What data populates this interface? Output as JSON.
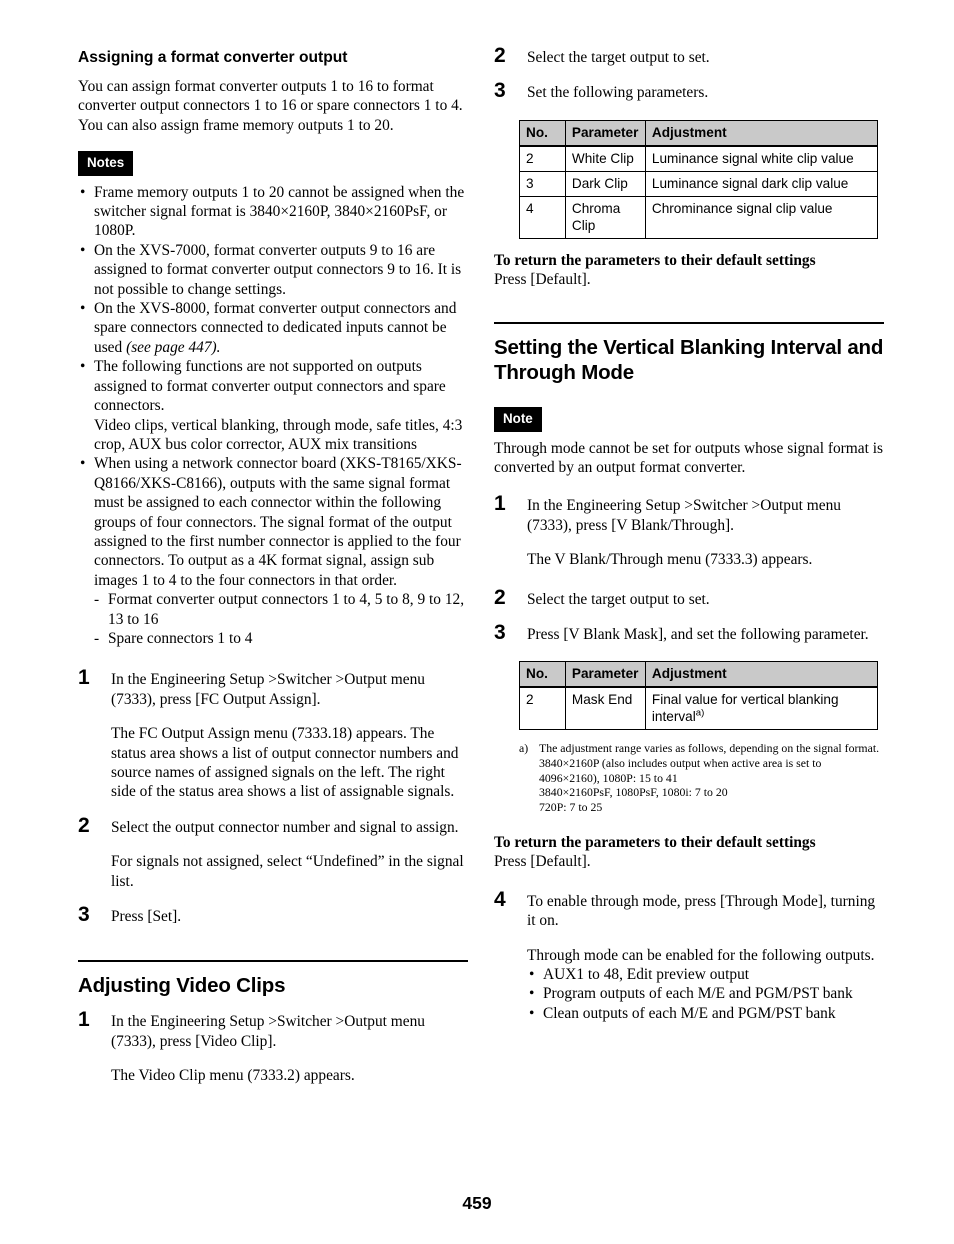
{
  "page": {
    "number": "459"
  },
  "left_column": {
    "heading": "Assigning a format converter output",
    "intro": [
      "You can assign format converter outputs 1 to 16 to format converter output connectors 1 to 16 or spare connectors 1 to 4.",
      "You can also assign frame memory outputs 1 to 20."
    ],
    "notes_badge": "Notes",
    "notes": [
      "Frame memory outputs 1 to 20 cannot be assigned when the switcher signal format is 3840×2160P, 3840×2160PsF, or 1080P.",
      "On the XVS-7000, format converter outputs 9 to 16 are assigned to format converter output connectors 9 to 16. It is not possible to change settings.",
      "The following functions are not supported on outputs assigned to format converter output connectors and spare connectors."
    ],
    "note_xvs8000_text": "On the XVS-8000, format converter output connectors and spare connectors connected to dedicated inputs cannot be used ",
    "note_xvs8000_italic": "(see page 447).",
    "note_functions_list": "Video clips, vertical blanking, through mode, safe titles, 4:3 crop, AUX bus color corrector, AUX mix transitions",
    "note_network_board": "When using a network connector board (XKS-T8165/XKS-Q8166/XKS-C8166), outputs with the same signal format must be assigned to each connector within the following groups of four connectors. The signal format of the output assigned to the first number connector is applied to the four connectors. To output as a 4K format signal, assign sub images 1 to 4 to the four connectors in that order.",
    "sub_items": [
      "Format converter output connectors 1 to 4, 5 to 8, 9 to 12, 13 to 16",
      "Spare connectors 1 to 4"
    ],
    "steps": [
      {
        "num": "1",
        "text": "In the Engineering Setup >Switcher >Output menu (7333), press [FC Output Assign].",
        "detail": "The FC Output Assign menu (7333.18) appears. The status area shows a list of output connector numbers and source names of assigned signals on the left. The right side of the status area shows a list of assignable signals."
      },
      {
        "num": "2",
        "text": "Select the output connector number and signal to assign.",
        "detail": "For signals not assigned, select “Undefined” in the signal list."
      },
      {
        "num": "3",
        "text": "Press [Set].",
        "detail": ""
      }
    ],
    "video_clips": {
      "heading": "Adjusting Video Clips",
      "step_num": "1",
      "step_text": "In the Engineering Setup >Switcher >Output menu (7333), press [Video Clip].",
      "step_detail": "The Video Clip menu (7333.2) appears."
    }
  },
  "right_column": {
    "steps_top": [
      {
        "num": "2",
        "text": "Select the target output to set."
      },
      {
        "num": "3",
        "text": "Set the following parameters."
      }
    ],
    "table_clip": {
      "headers": [
        "No.",
        "Parameter",
        "Adjustment"
      ],
      "rows": [
        {
          "no": "2",
          "parameter": "White Clip",
          "adjustment": "Luminance signal white clip value"
        },
        {
          "no": "3",
          "parameter": "Dark Clip",
          "adjustment": "Luminance signal dark clip value"
        },
        {
          "no": "4",
          "parameter": "Chroma Clip",
          "adjustment": "Chrominance signal clip value"
        }
      ]
    },
    "default_heading_1": "To return the parameters to their default settings",
    "default_text_1": "Press [Default].",
    "vblank": {
      "heading": "Setting the Vertical Blanking Interval and Through Mode",
      "note_badge": "Note",
      "note_text": "Through mode cannot be set for outputs whose signal format is converted by an output format converter.",
      "steps": [
        {
          "num": "1",
          "text": "In the Engineering Setup >Switcher >Output menu (7333), press [V Blank/Through].",
          "detail": "The V Blank/Through menu (7333.3) appears."
        },
        {
          "num": "2",
          "text": "Select the target output to set.",
          "detail": ""
        },
        {
          "num": "3",
          "text": "Press [V Blank Mask], and set the following parameter.",
          "detail": ""
        }
      ],
      "table_mask": {
        "headers": [
          "No.",
          "Parameter",
          "Adjustment"
        ],
        "rows": [
          {
            "no": "2",
            "parameter": "Mask End",
            "adjustment": "Final value for vertical blanking interval",
            "footnote_mark": "a)"
          }
        ]
      },
      "footnote": {
        "mark": "a)",
        "lines": [
          "The adjustment range varies as follows, depending on the signal format.",
          "3840×2160P (also includes output when active area is set to 4096×2160), 1080P: 15 to 41",
          "3840×2160PsF, 1080PsF, 1080i: 7 to 20",
          "720P: 7 to 25"
        ]
      },
      "default_heading_2": "To return the parameters to their default settings",
      "default_text_2": "Press [Default].",
      "step4": {
        "num": "4",
        "text": "To enable through mode, press [Through Mode], turning it on.",
        "detail": "Through mode can be enabled for the following outputs.",
        "outputs": [
          "AUX1 to 48, Edit preview output",
          "Program outputs of each M/E and PGM/PST bank",
          "Clean outputs of each M/E and PGM/PST bank"
        ]
      }
    }
  }
}
